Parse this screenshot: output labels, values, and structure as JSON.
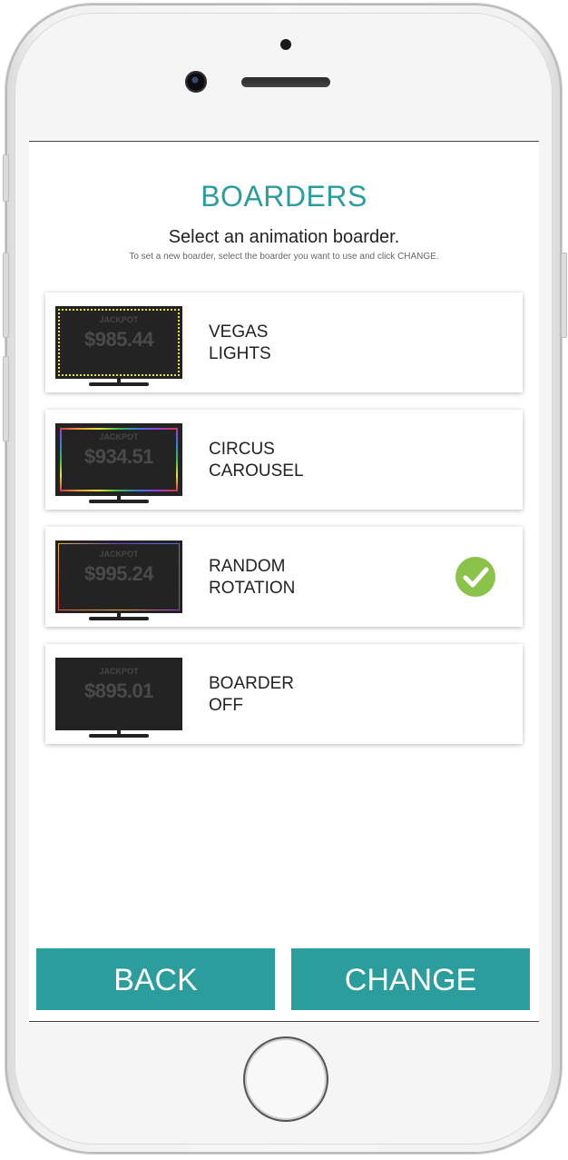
{
  "screen": {
    "title": "BOARDERS",
    "subtitle": "Select an animation boarder.",
    "hint": "To set a new boarder, select the boarder you want to use and click CHANGE."
  },
  "options": [
    {
      "line1": "VEGAS",
      "line2": "LIGHTS",
      "jackpot_label": "JACKPOT",
      "amount": "$985.44",
      "selected": false
    },
    {
      "line1": "CIRCUS",
      "line2": "CAROUSEL",
      "jackpot_label": "JACKPOT",
      "amount": "$934.51",
      "selected": false
    },
    {
      "line1": "RANDOM",
      "line2": "ROTATION",
      "jackpot_label": "JACKPOT",
      "amount": "$995.24",
      "selected": true
    },
    {
      "line1": "BOARDER",
      "line2": "OFF",
      "jackpot_label": "JACKPOT",
      "amount": "$895.01",
      "selected": false
    }
  ],
  "buttons": {
    "back_label": "BACK",
    "change_label": "CHANGE"
  },
  "colors": {
    "accent": "#2a9d9c",
    "check": "#8bc34a"
  },
  "icons": {
    "selected": "check-circle-icon"
  }
}
